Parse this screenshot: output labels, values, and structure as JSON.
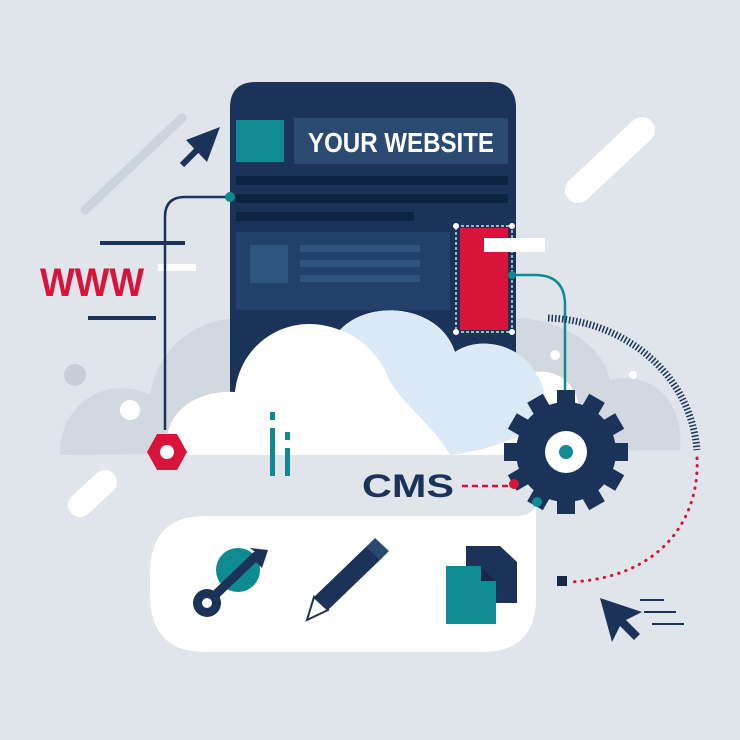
{
  "website_mockup": {
    "title": "YOUR WEBSITE"
  },
  "labels": {
    "www": "WWW",
    "cms": "CMS"
  },
  "toolbar": {
    "tools": [
      {
        "name": "wrench",
        "icon": "wrench-icon"
      },
      {
        "name": "pencil",
        "icon": "pencil-icon"
      },
      {
        "name": "files",
        "icon": "documents-icon"
      }
    ]
  },
  "icons": [
    "arrow-cursor-icon",
    "hex-nut-icon",
    "gear-icon",
    "info-icon",
    "mouse-pointer-icon"
  ],
  "colors": {
    "background": "#dfe5ea",
    "navy": "#1b3358",
    "navy_dark": "#16294a",
    "teal": "#0f8a93",
    "red": "#d9143a",
    "cloud": "#ffffff",
    "cloud_shade": "#dbe9f6",
    "panel_mid": "#2a4a72"
  }
}
